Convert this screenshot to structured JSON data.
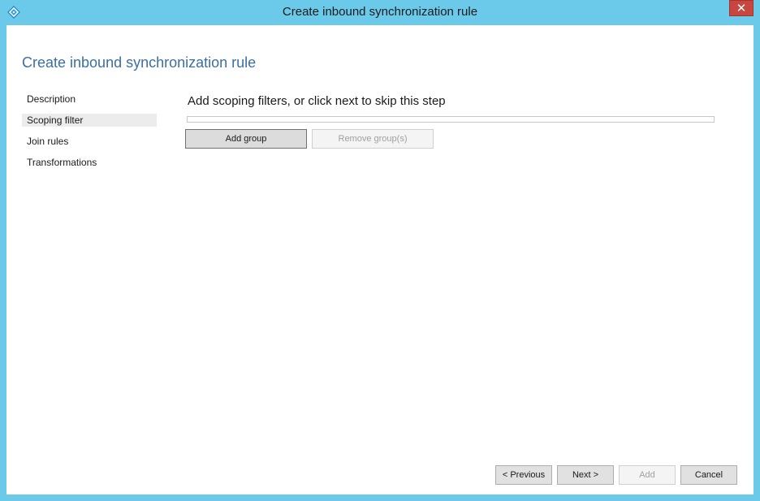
{
  "window": {
    "title": "Create inbound synchronization rule",
    "close_label": "✕",
    "icon": "sync-service-diamond-icon"
  },
  "page": {
    "heading": "Create inbound synchronization rule"
  },
  "nav": {
    "items": [
      {
        "label": "Description",
        "selected": false
      },
      {
        "label": "Scoping filter",
        "selected": true
      },
      {
        "label": "Join rules",
        "selected": false
      },
      {
        "label": "Transformations",
        "selected": false
      }
    ]
  },
  "main": {
    "step_title": "Add scoping filters, or click next to skip this step",
    "add_group_label": "Add group",
    "remove_group_label": "Remove group(s)"
  },
  "footer": {
    "previous_label": "< Previous",
    "next_label": "Next >",
    "add_label": "Add",
    "cancel_label": "Cancel"
  },
  "colors": {
    "frame": "#6bc9ea",
    "heading": "#3a6fa5",
    "close": "#c7463f"
  }
}
